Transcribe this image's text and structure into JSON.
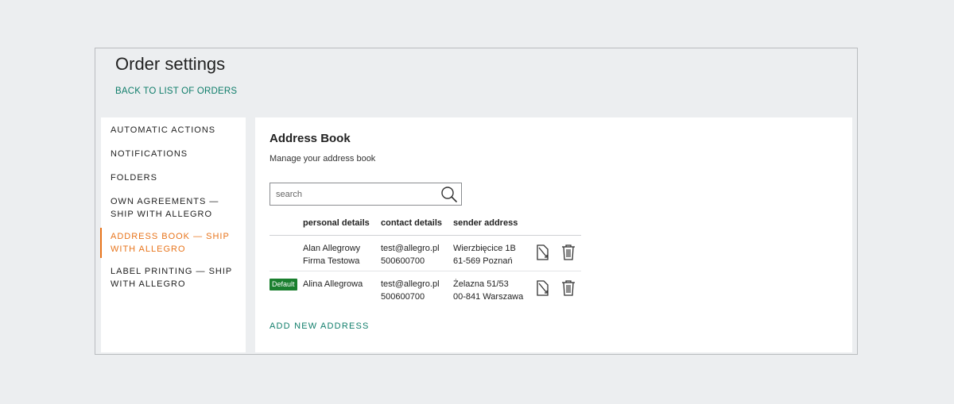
{
  "header": {
    "title": "Order settings",
    "back_link": "BACK TO LIST OF ORDERS"
  },
  "sidebar": {
    "items": [
      {
        "label": "AUTOMATIC ACTIONS",
        "active": false
      },
      {
        "label": "NOTIFICATIONS",
        "active": false
      },
      {
        "label": "FOLDERS",
        "active": false
      },
      {
        "label": "OWN AGREEMENTS — SHIP WITH ALLEGRO",
        "active": false
      },
      {
        "label": "ADDRESS BOOK — SHIP WITH ALLEGRO",
        "active": true
      },
      {
        "label": "LABEL PRINTING — SHIP WITH ALLEGRO",
        "active": false
      }
    ]
  },
  "main": {
    "title": "Address Book",
    "subtitle": "Manage your address book",
    "search": {
      "placeholder": "search",
      "value": ""
    },
    "table": {
      "columns": [
        "personal details",
        "contact details",
        "sender address"
      ],
      "rows": [
        {
          "badge": "",
          "personal": [
            "Alan Allegrowy",
            "Firma Testowa"
          ],
          "contact": [
            "test@allegro.pl",
            "500600700"
          ],
          "sender": [
            "Wierzbięcice 1B",
            "61-569 Poznań"
          ]
        },
        {
          "badge": "Default",
          "personal": [
            "Alina Allegrowa",
            ""
          ],
          "contact": [
            "test@allegro.pl",
            "500600700"
          ],
          "sender": [
            "Żelazna 51/53",
            "00-841 Warszawa"
          ]
        }
      ]
    },
    "add_link": "ADD NEW ADDRESS"
  },
  "icons": {
    "search": "search-icon",
    "edit": "edit-icon",
    "delete": "trash-icon"
  },
  "colors": {
    "accent_active": "#e8741b",
    "link": "#0f7d6a",
    "badge": "#1a7f2e",
    "background": "#eceef0"
  }
}
